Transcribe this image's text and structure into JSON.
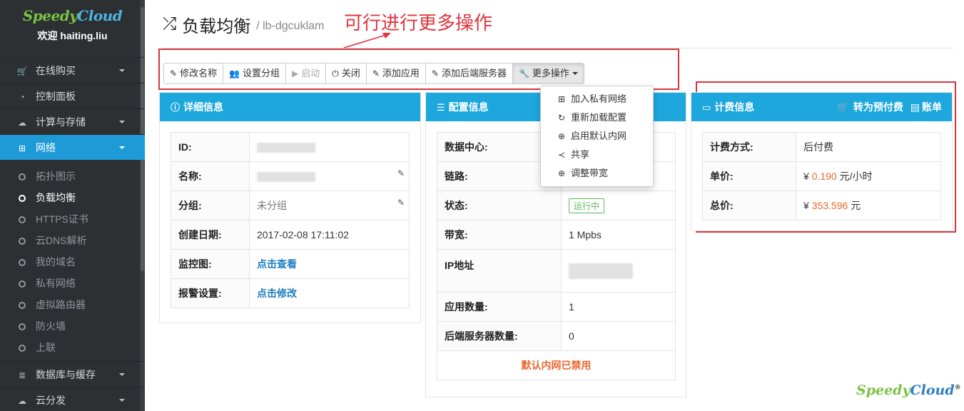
{
  "sidebar": {
    "logo_part1": "Speedy",
    "logo_part2": "Cloud",
    "welcome": "欢迎 haiting.liu",
    "nav_shop": "在线购买",
    "nav_dashboard": "控制面板",
    "nav_compute": "计算与存储",
    "nav_network": "网络",
    "sub_topology": "拓扑图示",
    "sub_lb": "负载均衡",
    "sub_https": "HTTPS证书",
    "sub_dns": "云DNS解析",
    "sub_domain": "我的域名",
    "sub_private": "私有网络",
    "sub_router": "虚拟路由器",
    "sub_firewall": "防火墙",
    "sub_uplink": "上联",
    "nav_db": "数据库与缓存",
    "nav_cdn": "云分发"
  },
  "header": {
    "title": "负载均衡",
    "subtitle": "/ lb-dgcuklam",
    "annotation": "可行进行更多操作"
  },
  "toolbar": {
    "rename": "修改名称",
    "group": "设置分组",
    "start": "启动",
    "close": "关闭",
    "add_app": "添加应用",
    "add_backend": "添加后端服务器",
    "more": "更多操作"
  },
  "dropdown": {
    "join_private": "加入私有网络",
    "reload": "重新加载配置",
    "enable_intranet": "启用默认内网",
    "share": "共享",
    "bandwidth": "调整带宽"
  },
  "detail": {
    "heading": "详细信息",
    "id_label": "ID:",
    "name_label": "名称:",
    "group_label": "分组:",
    "group_value": "未分组",
    "created_label": "创建日期:",
    "created_value": "2017-02-08 17:11:02",
    "monitor_label": "监控图:",
    "monitor_value": "点击查看",
    "alarm_label": "报警设置:",
    "alarm_value": "点击修改"
  },
  "config": {
    "heading": "配置信息",
    "dc_label": "数据中心:",
    "link_label": "链路:",
    "status_label": "状态:",
    "status_value": "运行中",
    "bw_label": "带宽:",
    "bw_value": "1 Mpbs",
    "ip_label": "IP地址",
    "app_count_label": "应用数量:",
    "app_count_value": "1",
    "backend_count_label": "后端服务器数量:",
    "backend_count_value": "0",
    "notice": "默认内网已禁用"
  },
  "billing": {
    "heading": "计费信息",
    "to_prepaid": "转为预付费",
    "bill": "账单",
    "method_label": "计费方式:",
    "method_value": "后付费",
    "unit_label": "单价:",
    "currency": "¥",
    "unit_value": "0.190",
    "unit_suffix": "元/小时",
    "total_label": "总价:",
    "total_value": "353.596",
    "total_suffix": "元"
  },
  "footer": {
    "logo_part1": "Speedy",
    "logo_part2": "Cloud",
    "reg": "®"
  }
}
